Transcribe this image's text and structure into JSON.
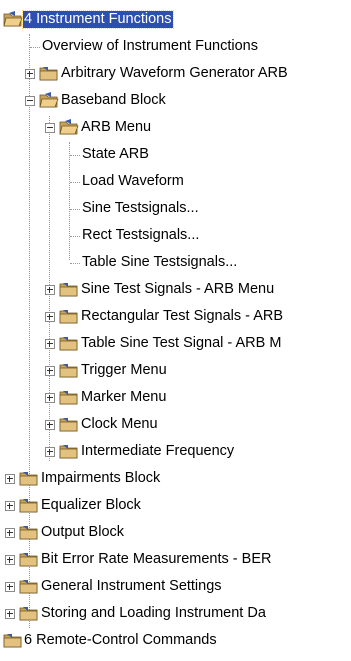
{
  "tree": {
    "root_top": {
      "label": "4 Instrument Functions",
      "expanded": true,
      "selected": true
    },
    "items": [
      {
        "label": "Overview of Instrument Functions"
      },
      {
        "label": "Arbitrary Waveform Generator ARB"
      },
      {
        "label": "Baseband Block"
      },
      {
        "label": "ARB Menu"
      },
      {
        "label": "State ARB"
      },
      {
        "label": "Load Waveform"
      },
      {
        "label": "Sine Testsignals..."
      },
      {
        "label": "Rect Testsignals..."
      },
      {
        "label": "Table Sine Testsignals..."
      },
      {
        "label": "Sine Test Signals - ARB Menu"
      },
      {
        "label": "Rectangular Test Signals - ARB"
      },
      {
        "label": "Table Sine Test Signal - ARB M"
      },
      {
        "label": "Trigger Menu"
      },
      {
        "label": "Marker Menu"
      },
      {
        "label": "Clock Menu"
      },
      {
        "label": "Intermediate Frequency"
      },
      {
        "label": "Impairments Block"
      },
      {
        "label": "Equalizer Block"
      },
      {
        "label": "Output Block"
      },
      {
        "label": "Bit Error Rate Measurements - BER"
      },
      {
        "label": "General Instrument Settings"
      },
      {
        "label": "Storing and Loading Instrument Da"
      }
    ],
    "root_bottom": {
      "label": "6 Remote-Control Commands"
    }
  },
  "colors": {
    "selection_bg": "#2f4fb0",
    "folder_tan": "#c9a35a",
    "folder_blue": "#3a5aa8"
  },
  "icons": {
    "folder": "folder-icon",
    "folder_open": "folder-open-icon",
    "expander_plus": "expand-plus-icon",
    "expander_minus": "collapse-minus-icon"
  }
}
